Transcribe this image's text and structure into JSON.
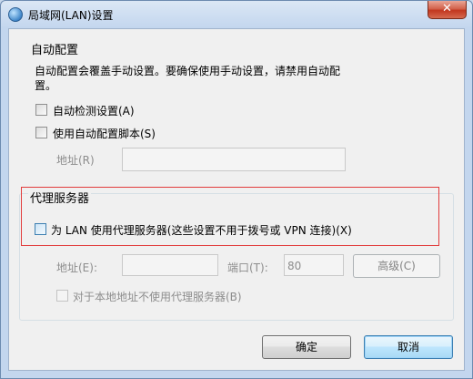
{
  "window": {
    "title": "局域网(LAN)设置",
    "close_symbol": "✕",
    "icon": "globe-network-icon"
  },
  "auto_config": {
    "group_title": "自动配置",
    "description_line1": "自动配置会覆盖手动设置。要确保使用手动设置，请禁用自动配",
    "description_line2": "置。",
    "auto_detect_label": "自动检测设置(A)",
    "auto_detect_checked": false,
    "use_script_label": "使用自动配置脚本(S)",
    "use_script_checked": false,
    "address_label": "地址(R)",
    "address_value": ""
  },
  "proxy": {
    "group_title": "代理服务器",
    "use_proxy_label": "为 LAN 使用代理服务器(这些设置不用于拨号或 VPN 连接)(X)",
    "use_proxy_checked": false,
    "address_label": "地址(E):",
    "address_value": "",
    "port_label": "端口(T):",
    "port_value": "80",
    "advanced_button": "高级(C)",
    "bypass_local_label": "对于本地地址不使用代理服务器(B)",
    "bypass_local_checked": false,
    "highlight_color": "#e23c3c"
  },
  "footer": {
    "ok_button": "确定",
    "cancel_button": "取消"
  }
}
